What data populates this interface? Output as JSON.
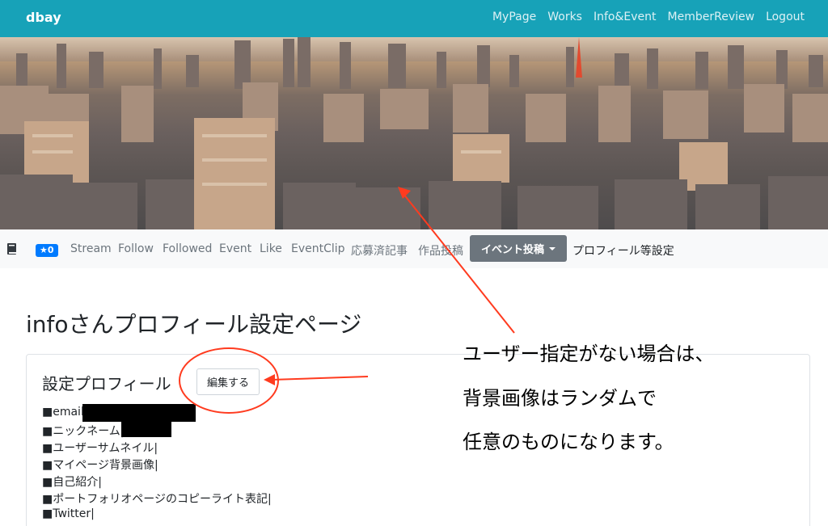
{
  "navbar": {
    "brand": "dbay",
    "links": [
      "MyPage",
      "Works",
      "Info&Event",
      "MemberReview",
      "Logout"
    ]
  },
  "subnav": {
    "badge": "★0",
    "items": [
      "Stream",
      "Follow",
      "Followed",
      "Event",
      "Like",
      "EventClip",
      "応募済記事",
      "作品投稿"
    ],
    "dropdown_label": "イベント投稿",
    "settings_link": "プロフィール等設定"
  },
  "page": {
    "title": "infoさんプロフィール設定ページ"
  },
  "profile": {
    "heading": "設定プロフィール",
    "edit_button": "編集する",
    "fields": [
      "■email|",
      "■ニックネーム|",
      "■ユーザーサムネイル|",
      "■マイページ背景画像|",
      "■自己紹介|",
      "■ポートフォリオページのコピーライト表記|",
      "■Twitter|"
    ]
  },
  "annotation": {
    "lines": [
      "ユーザー指定がない場合は、",
      "背景画像はランダムで",
      "任意のものになります。"
    ],
    "color": "#ff3b1f"
  },
  "colors": {
    "navbar": "#17a2b8",
    "badge": "#007bff",
    "dropdown": "#6c757d"
  }
}
